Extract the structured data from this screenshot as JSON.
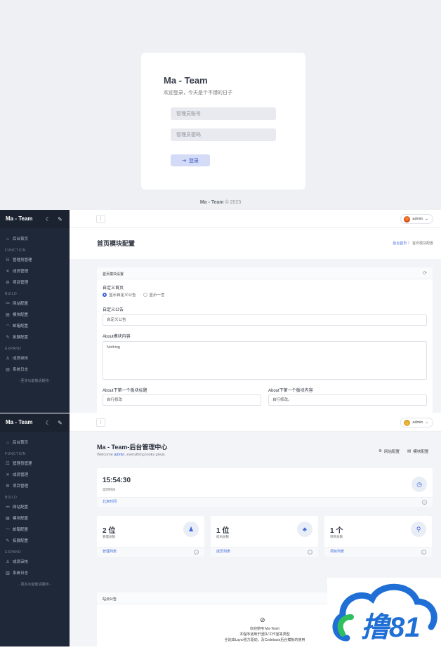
{
  "login": {
    "title": "Ma - Team",
    "subtitle": "欢迎登录，今天是个不错的日子",
    "username_placeholder": "管理员账号",
    "password_placeholder": "管理员密码",
    "button_label": "登录",
    "footer_name": "Ma - Team",
    "footer_copy": "© 2023"
  },
  "sidebar": {
    "brand": "Ma - Team",
    "items": [
      {
        "type": "item",
        "icon": "⌂",
        "label": "后台首页"
      },
      {
        "type": "group",
        "label": "FUNCTION"
      },
      {
        "type": "item",
        "icon": "☷",
        "label": "管理员管理"
      },
      {
        "type": "item",
        "icon": "✕",
        "label": "成员管理"
      },
      {
        "type": "item",
        "icon": "⚙",
        "label": "项目管理"
      },
      {
        "type": "group",
        "label": "BUILD"
      },
      {
        "type": "item",
        "icon": "⚯",
        "label": "网站配置"
      },
      {
        "type": "item",
        "icon": "▤",
        "label": "模块配置"
      },
      {
        "type": "item",
        "icon": "◠",
        "label": "邮箱配置"
      },
      {
        "type": "item",
        "icon": "✎",
        "label": "拓展配置"
      },
      {
        "type": "group",
        "label": "EXPAND"
      },
      {
        "type": "item",
        "icon": "♙",
        "label": "成员审核"
      },
      {
        "type": "item",
        "icon": "▥",
        "label": "系统日志"
      }
    ],
    "more": "- 更多功能敬请期待 -"
  },
  "topbar": {
    "menu_icon": "⋮",
    "user": "admin"
  },
  "module_page": {
    "title": "首页模块配置",
    "breadcrumb_home": "后台首页",
    "breadcrumb_current": "首页模块配置",
    "card_title": "首页模块设置",
    "field_custom_home": "自定义首页",
    "radio_custom_notice": "显示自定义公告",
    "radio_hitokoto": "显示一言",
    "field_custom_notice": "自定义公告",
    "custom_notice_value": "自定义公告",
    "field_about": "About模块内容",
    "about_value": "Nothing",
    "field_next_title": "About下第一个板块标题",
    "next_title_value": "自行修改",
    "field_next_content": "About下第一个板块内容",
    "next_content_value": "自行修改。"
  },
  "dashboard": {
    "title": "Ma - Team-后台管理中心",
    "welcome_prefix": "Welcome ",
    "welcome_name": "admin",
    "welcome_suffix": ", everything looks great.",
    "link_site": "网站配置",
    "link_module": "模块配置",
    "time_value": "15:54:30",
    "time_label": "实时时间",
    "time_footer": "北京时间",
    "stats": [
      {
        "value": "2 位",
        "label": "管理总数",
        "footer": "管理列表",
        "icon": "♟"
      },
      {
        "value": "1 位",
        "label": "成员总数",
        "footer": "成员列表",
        "icon": "♣"
      },
      {
        "value": "1 个",
        "label": "项目总数",
        "footer": "项目列表",
        "icon": "⚲"
      }
    ],
    "notice_title": "站点公告",
    "notice_lines": [
      "欢迎使用 Ma-Team",
      "本程序适用于团队/工作室等类型",
      "全站由Layui强力驱动，及Codebase后台模板的使用"
    ]
  },
  "watermark_text": "撸81",
  "colors": {
    "accent": "#3d66d9",
    "sidebar": "#1f2838",
    "watermark": "#1f6fd6",
    "watermark_green": "#2fbf5f"
  }
}
